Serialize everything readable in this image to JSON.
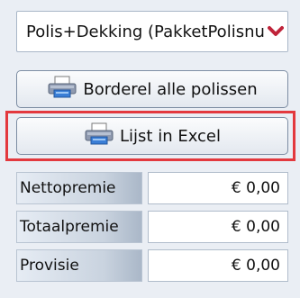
{
  "policy_dropdown": {
    "selected": "Polis+Dekking (PakketPolisnummer)",
    "arrow_color": "#c0243a"
  },
  "buttons": {
    "borderel_label": "Borderel alle polissen",
    "excel_label": "Lijst in Excel"
  },
  "highlight_color": "#e3393e",
  "summary": [
    {
      "label": "Nettopremie",
      "value": "€ 0,00"
    },
    {
      "label": "Totaalpremie",
      "value": "€ 0,00"
    },
    {
      "label": "Provisie",
      "value": "€ 0,00"
    }
  ]
}
